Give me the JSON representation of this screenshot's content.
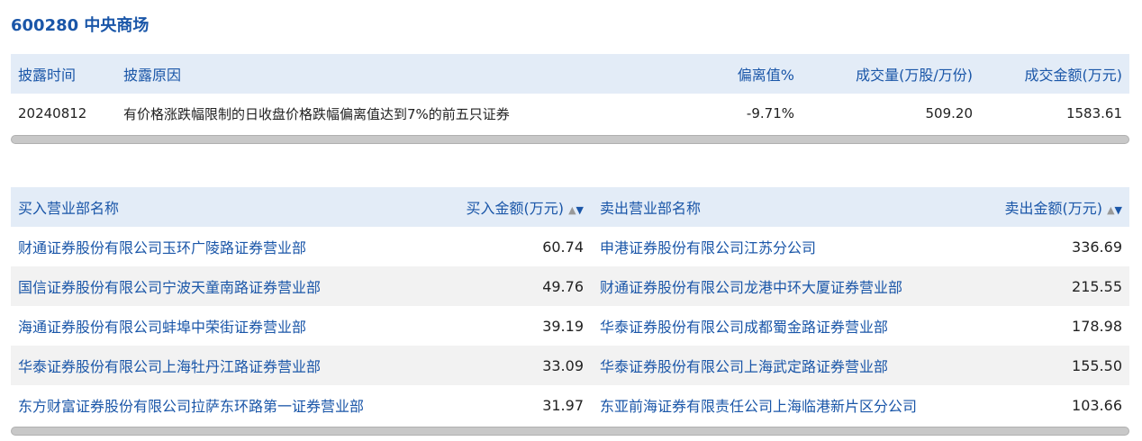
{
  "header": {
    "title": "600280 中央商场"
  },
  "summary": {
    "columns": [
      "披露时间",
      "披露原因",
      "偏离值%",
      "成交量(万股/万份)",
      "成交金额(万元)"
    ],
    "row": {
      "date": "20240812",
      "reason": "有价格涨跌幅限制的日收盘价格跌幅偏离值达到7%的前五只证券",
      "deviation": "-9.71%",
      "volume": "509.20",
      "amount": "1583.61"
    }
  },
  "buy": {
    "header_name": "买入营业部名称",
    "header_amount": "买入金额(万元)",
    "rows": [
      {
        "name": "财通证券股份有限公司玉环广陵路证券营业部",
        "amount": "60.74"
      },
      {
        "name": "国信证券股份有限公司宁波天童南路证券营业部",
        "amount": "49.76"
      },
      {
        "name": "海通证券股份有限公司蚌埠中荣街证券营业部",
        "amount": "39.19"
      },
      {
        "name": "华泰证券股份有限公司上海牡丹江路证券营业部",
        "amount": "33.09"
      },
      {
        "name": "东方财富证券股份有限公司拉萨东环路第一证券营业部",
        "amount": "31.97"
      }
    ]
  },
  "sell": {
    "header_name": "卖出营业部名称",
    "header_amount": "卖出金额(万元)",
    "rows": [
      {
        "name": "申港证券股份有限公司江苏分公司",
        "amount": "336.69"
      },
      {
        "name": "财通证券股份有限公司龙港中环大厦证券营业部",
        "amount": "215.55"
      },
      {
        "name": "华泰证券股份有限公司成都蜀金路证券营业部",
        "amount": "178.98"
      },
      {
        "name": "华泰证券股份有限公司上海武定路证券营业部",
        "amount": "155.50"
      },
      {
        "name": "东亚前海证券有限责任公司上海临港新片区分公司",
        "amount": "103.66"
      }
    ]
  },
  "icons": {
    "sort": "sort-up-down-icon"
  },
  "colors": {
    "accent": "#1a56a8",
    "header_bg": "#e3ecf7",
    "alt_row": "#f2f2f2"
  }
}
